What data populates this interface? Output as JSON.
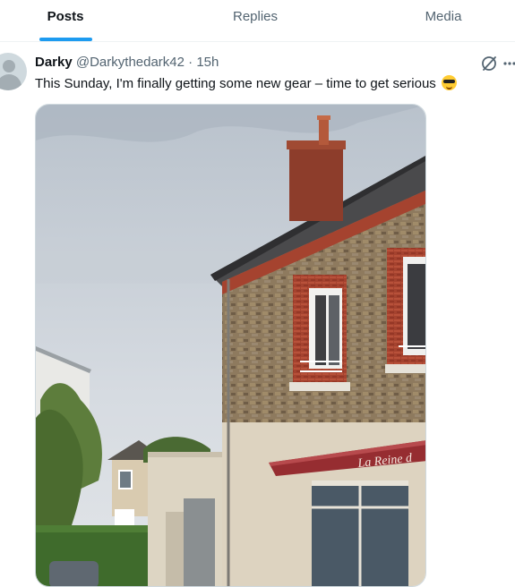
{
  "tabs": [
    {
      "label": "Posts",
      "active": true
    },
    {
      "label": "Replies",
      "active": false
    },
    {
      "label": "Media",
      "active": false
    }
  ],
  "colors": {
    "accent": "#1d9bf0",
    "secondary_text": "#536471",
    "primary_text": "#0f1419"
  },
  "tweet": {
    "author_name": "Darky",
    "handle": "@Darkythedark42",
    "separator": "·",
    "time": "15h",
    "text": "This Sunday, I'm finally getting some new gear – time to get serious",
    "emoji": "😎",
    "icons": [
      "avatar",
      "grok-icon",
      "more-icon"
    ],
    "image": {
      "description_icon": "photo",
      "sign_text": "La Reine d"
    }
  }
}
